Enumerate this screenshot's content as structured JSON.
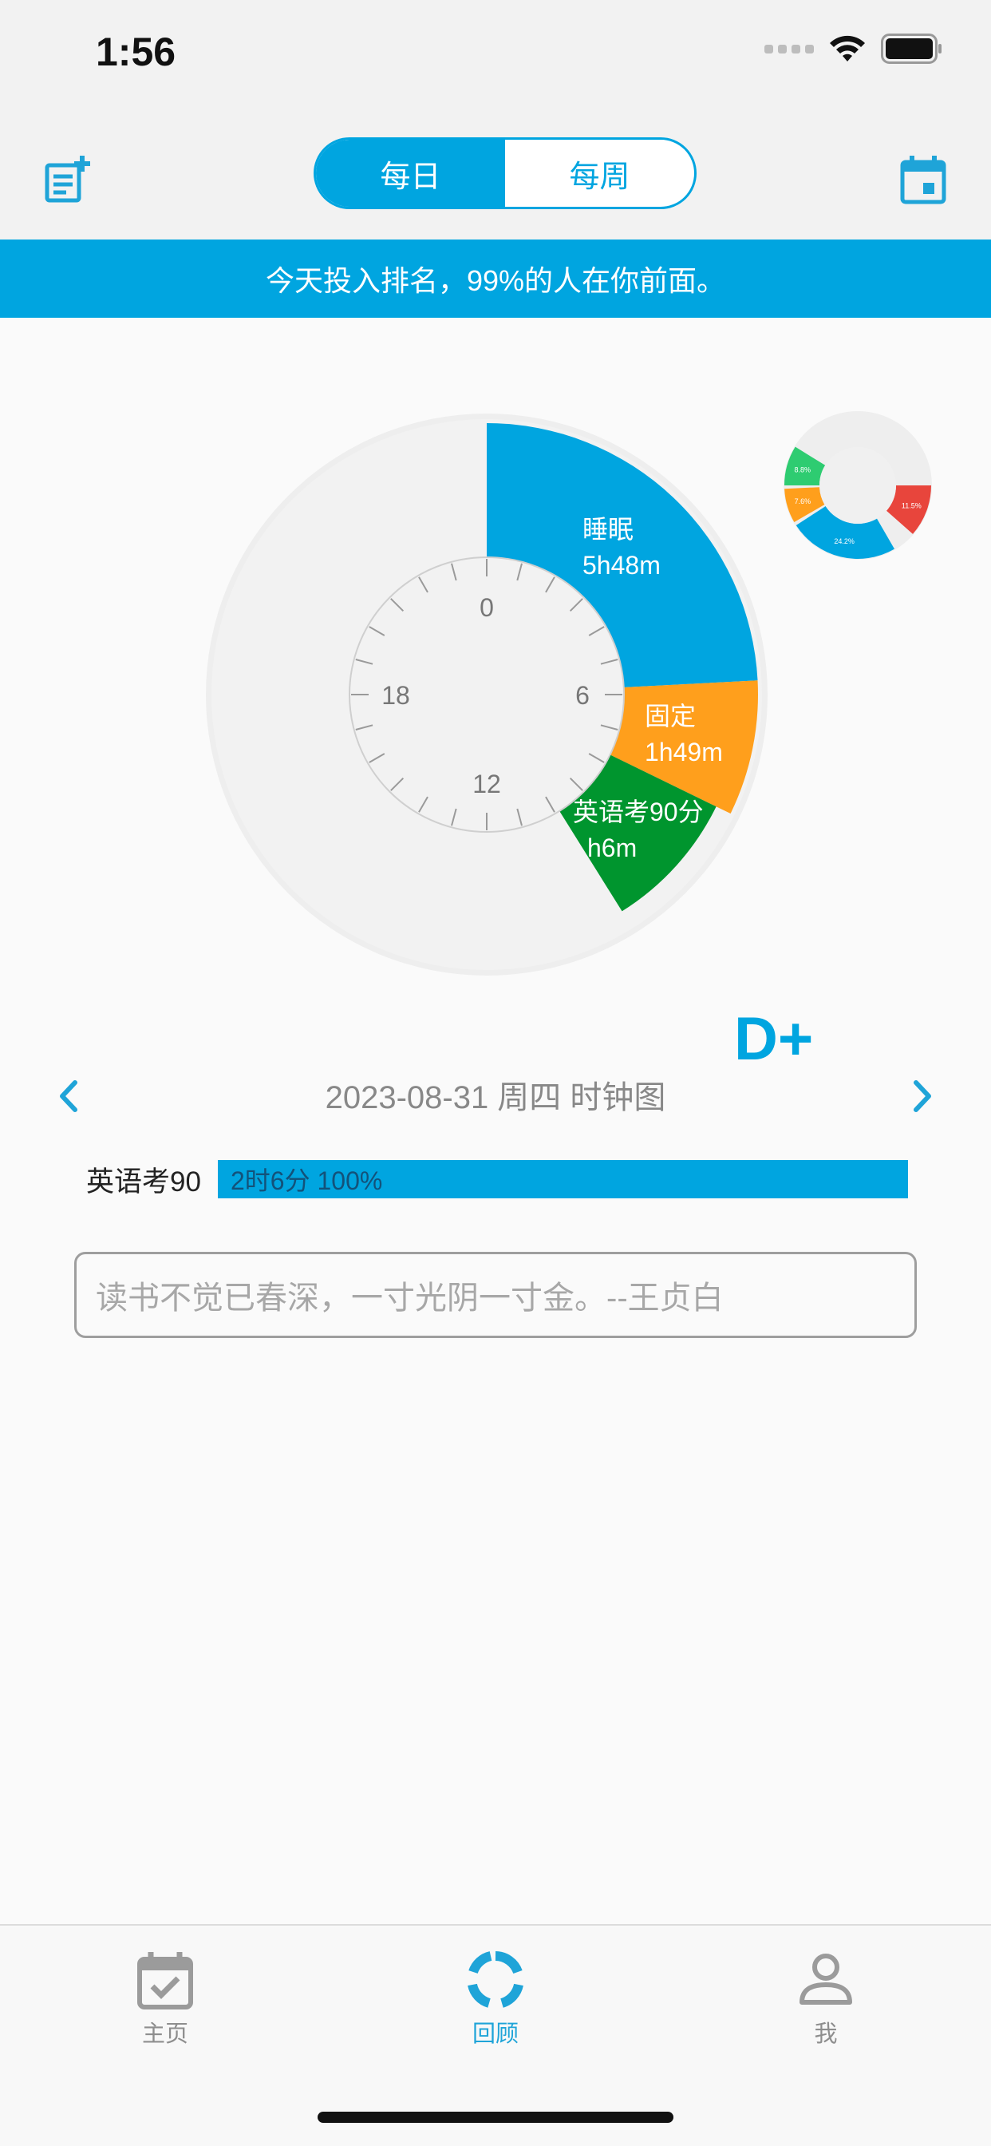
{
  "status_bar": {
    "time": "1:56"
  },
  "header": {
    "left_icon": "add-note-icon",
    "right_icon": "calendar-icon",
    "tabs": [
      {
        "label": "每日",
        "active": true
      },
      {
        "label": "每周",
        "active": false
      }
    ]
  },
  "banner": {
    "text": "今天投入排名，99%的人在你前面。"
  },
  "clock": {
    "tick_labels": [
      "0",
      "6",
      "12",
      "18"
    ],
    "segments": [
      {
        "name": "睡眠",
        "duration": "5h48m",
        "color": "#00a5e0"
      },
      {
        "name": "固定",
        "duration": "1h49m",
        "color": "#ff9f1c"
      },
      {
        "name": "英语考90分",
        "duration": "h6m",
        "color": "#00952e"
      }
    ]
  },
  "chart_data": {
    "type": "pie",
    "slices": [
      {
        "label": "11.5%",
        "value": 11.5,
        "color": "#e8453c"
      },
      {
        "label": "24.2%",
        "value": 24.2,
        "color": "#00a5e0"
      },
      {
        "label": "7.6%",
        "value": 7.6,
        "color": "#ff9f1c"
      },
      {
        "label": "8.8%",
        "value": 8.8,
        "color": "#2ecc71"
      }
    ]
  },
  "grade": "D+",
  "date_nav": {
    "label": "2023-08-31 周四 时钟图"
  },
  "task": {
    "name": "英语考90",
    "bar_text": "2时6分 100%",
    "percent": 100
  },
  "quote": {
    "placeholder": "读书不觉已春深，一寸光阴一寸金。--王贞白"
  },
  "tab_bar": {
    "items": [
      {
        "label": "主页",
        "icon": "calendar-check-icon"
      },
      {
        "label": "回顾",
        "icon": "review-ring-icon",
        "active": true
      },
      {
        "label": "我",
        "icon": "person-icon"
      }
    ]
  }
}
